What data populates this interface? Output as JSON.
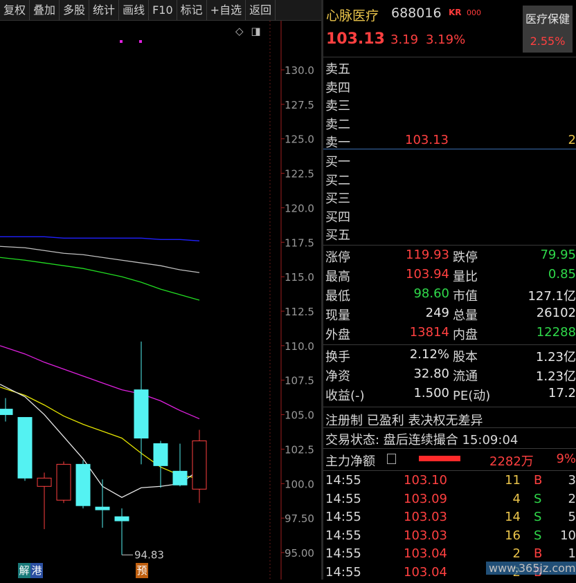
{
  "toolbar": {
    "items": [
      "复权",
      "叠加",
      "多股",
      "统计",
      "画线",
      "F10",
      "标记",
      "+自选",
      "返回"
    ]
  },
  "chart": {
    "y_axis_ticks": [
      "130.0",
      "127.5",
      "125.0",
      "122.5",
      "120.0",
      "117.5",
      "115.0",
      "112.5",
      "110.0",
      "107.5",
      "105.0",
      "102.5",
      "100.0",
      "97.50",
      "95.00"
    ],
    "low_annotation": "94.83",
    "badge_jie": "解",
    "badge_gang": "港",
    "badge_yu": "预",
    "colors": {
      "up": "#ff4040",
      "down": "#54f2f2",
      "ma_white": "#e8e8e8",
      "ma_yellow": "#e5e500",
      "ma_magenta": "#e020e0",
      "ma_green": "#22dd22",
      "ma_gray": "#c0c0c0",
      "ma_blue": "#2020ff",
      "axis": "#a02020"
    }
  },
  "chart_data": {
    "type": "candlestick",
    "y_range": [
      95,
      130
    ],
    "candles": [
      {
        "open": 105.4,
        "close": 105.0,
        "high": 106.2,
        "low": 104.5
      },
      {
        "open": 104.8,
        "close": 100.4,
        "high": 104.8,
        "low": 100.2
      },
      {
        "open": 99.8,
        "close": 100.4,
        "high": 100.8,
        "low": 96.7
      },
      {
        "open": 98.8,
        "close": 101.4,
        "high": 101.6,
        "low": 98.6
      },
      {
        "open": 101.4,
        "close": 98.4,
        "high": 101.7,
        "low": 98.2
      },
      {
        "open": 98.3,
        "close": 98.1,
        "high": 100.3,
        "low": 96.8
      },
      {
        "open": 97.6,
        "close": 97.3,
        "high": 98.2,
        "low": 94.83
      },
      {
        "open": 106.8,
        "close": 103.3,
        "high": 110.3,
        "low": 101.4
      },
      {
        "open": 102.9,
        "close": 101.3,
        "high": 103.1,
        "low": 99.7
      },
      {
        "open": 100.9,
        "close": 99.9,
        "high": 102.9,
        "low": 99.8
      },
      {
        "open": 99.6,
        "close": 103.1,
        "high": 103.9,
        "low": 98.6
      }
    ],
    "moving_averages": [
      {
        "color": "blue",
        "values": [
          117.9,
          117.9,
          117.9,
          117.8,
          117.8,
          117.8,
          117.8,
          117.8,
          117.7,
          117.7,
          117.6
        ]
      },
      {
        "color": "gray",
        "values": [
          117.2,
          117.1,
          116.9,
          116.7,
          116.6,
          116.4,
          116.2,
          116.0,
          115.8,
          115.5,
          115.3
        ]
      },
      {
        "color": "green",
        "values": [
          116.4,
          116.2,
          116.0,
          115.8,
          115.6,
          115.3,
          115.0,
          114.6,
          114.1,
          113.7,
          113.3
        ]
      },
      {
        "color": "magenta",
        "values": [
          110.0,
          109.4,
          108.8,
          108.3,
          107.8,
          107.3,
          106.8,
          106.5,
          106.0,
          105.3,
          104.7
        ]
      },
      {
        "color": "yellow",
        "values": [
          107.0,
          106.4,
          105.7,
          104.9,
          104.3,
          103.8,
          103.3,
          102.2,
          101.2,
          100.6,
          100.4
        ]
      },
      {
        "color": "white",
        "values": [
          107.2,
          106.3,
          105.0,
          103.4,
          101.8,
          99.8,
          99.0,
          99.7,
          99.8,
          100.0,
          101.0
        ]
      }
    ]
  },
  "quote": {
    "name": "心脉医疗",
    "code": "688016",
    "kr": "KR",
    "kr_suffix": "000",
    "sector_name": "医疗保健",
    "sector_pct": "2.55%",
    "price": "103.13",
    "change": "3.19",
    "change_pct": "3.19%"
  },
  "order_book": {
    "asks": [
      {
        "label": "卖五",
        "price": "",
        "vol": ""
      },
      {
        "label": "卖四",
        "price": "",
        "vol": ""
      },
      {
        "label": "卖三",
        "price": "",
        "vol": ""
      },
      {
        "label": "卖二",
        "price": "",
        "vol": ""
      },
      {
        "label": "卖一",
        "price": "103.13",
        "vol": "2"
      }
    ],
    "bids": [
      {
        "label": "买一",
        "price": "",
        "vol": ""
      },
      {
        "label": "买二",
        "price": "",
        "vol": ""
      },
      {
        "label": "买三",
        "price": "",
        "vol": ""
      },
      {
        "label": "买四",
        "price": "",
        "vol": ""
      },
      {
        "label": "买五",
        "price": "",
        "vol": ""
      }
    ]
  },
  "stats": [
    {
      "l1": "涨停",
      "v1": "119.93",
      "c1": "red",
      "l2": "跌停",
      "v2": "79.95",
      "c2": "green"
    },
    {
      "l1": "最高",
      "v1": "103.94",
      "c1": "red",
      "l2": "量比",
      "v2": "0.85",
      "c2": "green"
    },
    {
      "l1": "最低",
      "v1": "98.60",
      "c1": "green",
      "l2": "市值",
      "v2": "127.1亿",
      "c2": "white"
    },
    {
      "l1": "现量",
      "v1": "249",
      "c1": "white",
      "l2": "总量",
      "v2": "26102",
      "c2": "white"
    },
    {
      "l1": "外盘",
      "v1": "13814",
      "c1": "red",
      "l2": "内盘",
      "v2": "12288",
      "c2": "green"
    },
    {
      "l1": "换手",
      "v1": "2.12%",
      "c1": "white",
      "l2": "股本",
      "v2": "1.23亿",
      "c2": "white"
    },
    {
      "l1": "净资",
      "v1": "32.80",
      "c1": "white",
      "l2": "流通",
      "v2": "1.23亿",
      "c2": "white"
    },
    {
      "l1": "收益(-)",
      "v1": "1.500",
      "c1": "white",
      "l2": "PE(动)",
      "v2": "17.2",
      "c2": "white"
    }
  ],
  "tags": "注册制 已盈利 表决权无差异",
  "status": "交易状态: 盘后连续撮合 15:09:04",
  "main_flow": {
    "label": "主力净额",
    "amount": "2282万",
    "pct": "9%"
  },
  "ticks": [
    {
      "time": "14:55",
      "price": "103.10",
      "vol": "11",
      "side": "B",
      "n": "3"
    },
    {
      "time": "14:55",
      "price": "103.09",
      "vol": "4",
      "side": "S",
      "n": "2"
    },
    {
      "time": "14:55",
      "price": "103.03",
      "vol": "14",
      "side": "S",
      "n": "5"
    },
    {
      "time": "14:55",
      "price": "103.03",
      "vol": "16",
      "side": "S",
      "n": "10"
    },
    {
      "time": "14:55",
      "price": "103.04",
      "vol": "2",
      "side": "B",
      "n": "1"
    },
    {
      "time": "14:55",
      "price": "103.04",
      "vol": "2",
      "side": "B",
      "n": ""
    }
  ],
  "watermark": "www.365jz.com"
}
